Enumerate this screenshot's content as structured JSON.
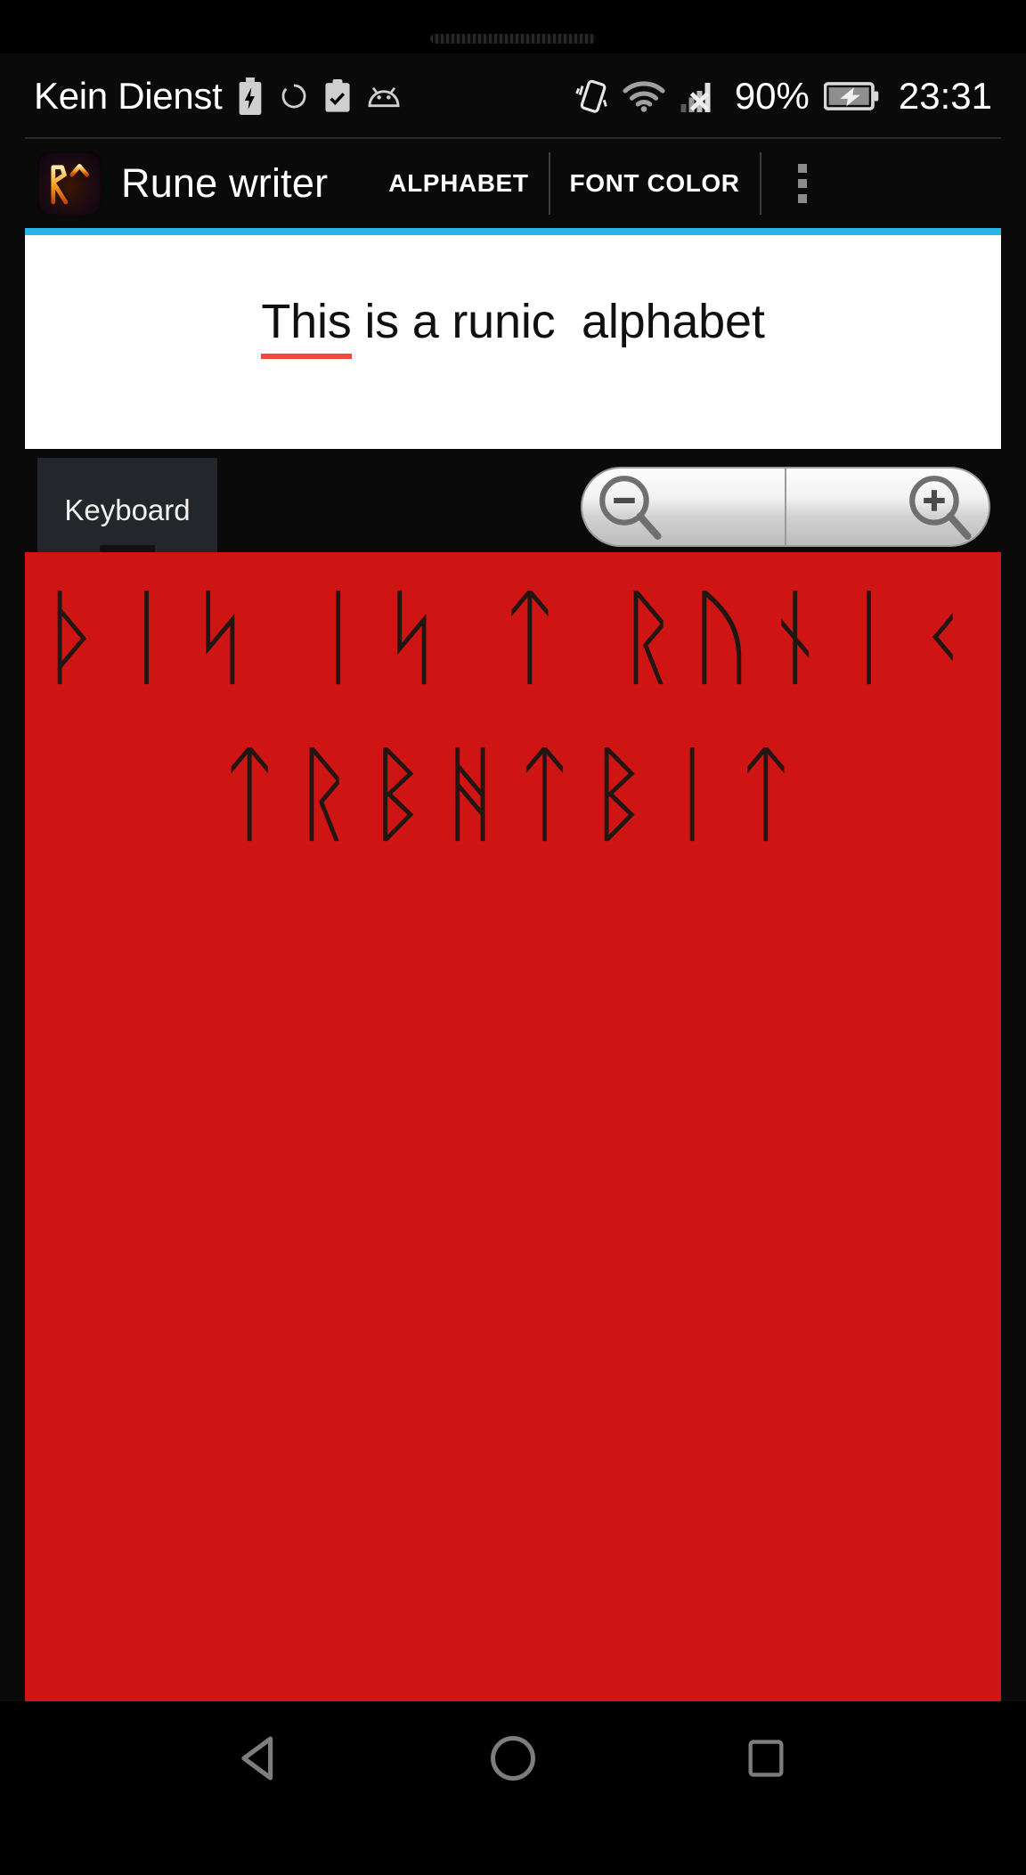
{
  "statusbar": {
    "carrier": "Kein Dienst",
    "battery_percent": "90%",
    "clock": "23:31",
    "icons_left": [
      "battery-saver-icon",
      "sync-icon",
      "clipboard-check-icon",
      "android-icon"
    ],
    "icons_right": [
      "vibrate-icon",
      "wifi-icon",
      "signal-no-sim-icon",
      "battery-charging-icon"
    ]
  },
  "appbar": {
    "logo_text": "RT",
    "title": "Rune writer",
    "action_alphabet": "ALPHABET",
    "action_font_color": "FONT COLOR",
    "overflow_label": "More options"
  },
  "editor": {
    "text_misspelled": "This",
    "text_rest": " is a runic  alphabet",
    "full_text": "This is a runic  alphabet",
    "background": "#ffffff",
    "accent_color": "#2bb3e8",
    "spellcheck_color": "#f4483f"
  },
  "controls": {
    "keyboard_label": "Keyboard",
    "zoom_out_label": "zoom-out",
    "zoom_in_label": "zoom-in"
  },
  "runes": {
    "background": "#cf1414",
    "glyph_color": "#231512",
    "line1": "ᚦᛁᛋ ᛁᛋ ᛏ ᚱᚢᚾᛁᚲ",
    "line2": "ᛏᚱᛒᚻᛏᛒᛁᛏ"
  },
  "navbar": {
    "back_label": "Back",
    "home_label": "Home",
    "recents_label": "Recents",
    "icon_color": "#7d7d7d"
  }
}
